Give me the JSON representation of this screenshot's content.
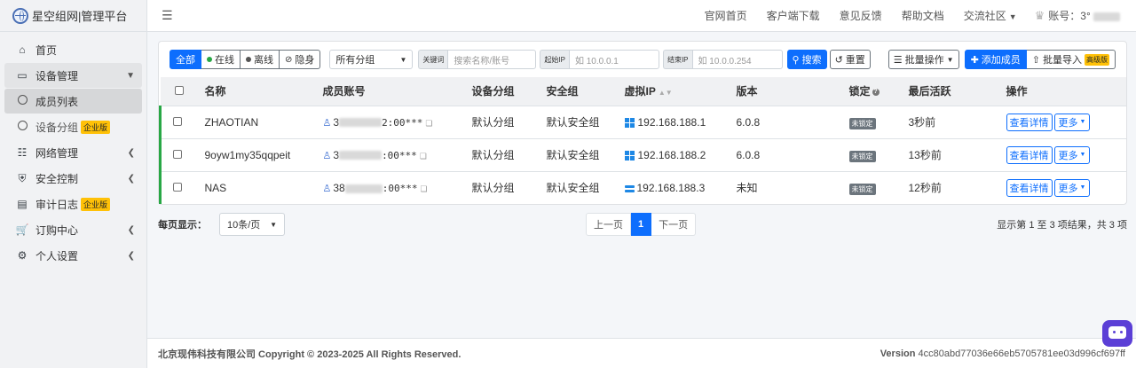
{
  "sidebar": {
    "brand_title": "星空组网|管理平台",
    "items": [
      {
        "label": "首页",
        "icon": "home-icon"
      },
      {
        "label": "设备管理",
        "icon": "monitor-icon"
      },
      {
        "label": "成员列表",
        "icon": "circle-icon"
      },
      {
        "label": "设备分组",
        "icon": "circle-icon",
        "badge": "企业版"
      },
      {
        "label": "网络管理",
        "icon": "network-icon"
      },
      {
        "label": "安全控制",
        "icon": "shield-icon"
      },
      {
        "label": "审计日志",
        "icon": "clipboard-icon",
        "badge": "企业版"
      },
      {
        "label": "订购中心",
        "icon": "cart-icon"
      },
      {
        "label": "个人设置",
        "icon": "user-gear-icon"
      }
    ]
  },
  "topbar": {
    "links": [
      "官网首页",
      "客户端下载",
      "意见反馈",
      "帮助文档",
      "交流社区"
    ],
    "account_label": "账号：3ᐤ"
  },
  "toolbar": {
    "filters": [
      "全部",
      "在线",
      "离线",
      "隐身"
    ],
    "group_select": "所有分组",
    "keyword_label": "关键词",
    "keyword_placeholder": "搜索名称/账号",
    "start_ip_label": "起始IP",
    "start_ip_placeholder": "如 10.0.0.1",
    "end_ip_label": "结束IP",
    "end_ip_placeholder": "如 10.0.0.254",
    "search_label": "搜索",
    "reset_label": "重置",
    "batch_ops_label": "批量操作",
    "add_member_label": "添加成员",
    "batch_import_label": "批量导入",
    "advanced_tag": "高级版"
  },
  "table": {
    "headers": [
      "名称",
      "成员账号",
      "设备分组",
      "安全组",
      "虚拟IP",
      "版本",
      "锁定",
      "最后活跃",
      "操作"
    ],
    "rows": [
      {
        "name": "ZHAOTIAN",
        "account_prefix": "3",
        "account_suffix": "2:00***",
        "group": "默认分组",
        "security": "默认安全组",
        "ip": "192.168.188.1",
        "os": "windows-icon",
        "version": "6.0.8",
        "lock": "未锁定",
        "last_active": "3秒前"
      },
      {
        "name": "9oyw1my35qqpeit",
        "account_prefix": "3",
        "account_suffix": ":00***",
        "group": "默认分组",
        "security": "默认安全组",
        "ip": "192.168.188.2",
        "os": "windows-icon",
        "version": "6.0.8",
        "lock": "未锁定",
        "last_active": "13秒前"
      },
      {
        "name": "NAS",
        "account_prefix": "38",
        "account_suffix": ":00***",
        "group": "默认分组",
        "security": "默认安全组",
        "ip": "192.168.188.3",
        "os": "nas-icon",
        "version": "未知",
        "lock": "未锁定",
        "last_active": "12秒前"
      }
    ],
    "detail_label": "查看详情",
    "more_label": "更多"
  },
  "pager": {
    "per_page_label": "每页显示：",
    "per_page_value": "10条/页",
    "prev_label": "上一页",
    "current_page": "1",
    "next_label": "下一页",
    "result_text": "显示第 1 至 3 项结果，共 3 项"
  },
  "footer": {
    "copyright": "北京现伟科技有限公司 Copyright © 2023-2025 All Rights Reserved.",
    "version_label": "Version",
    "version_value": "4cc80abd77036e66eb5705781ee03d996cf697ff"
  },
  "colors": {
    "primary": "#0d6efd",
    "online": "#28a745",
    "offline": "#555555",
    "enterprise_badge": "#ffc107"
  }
}
